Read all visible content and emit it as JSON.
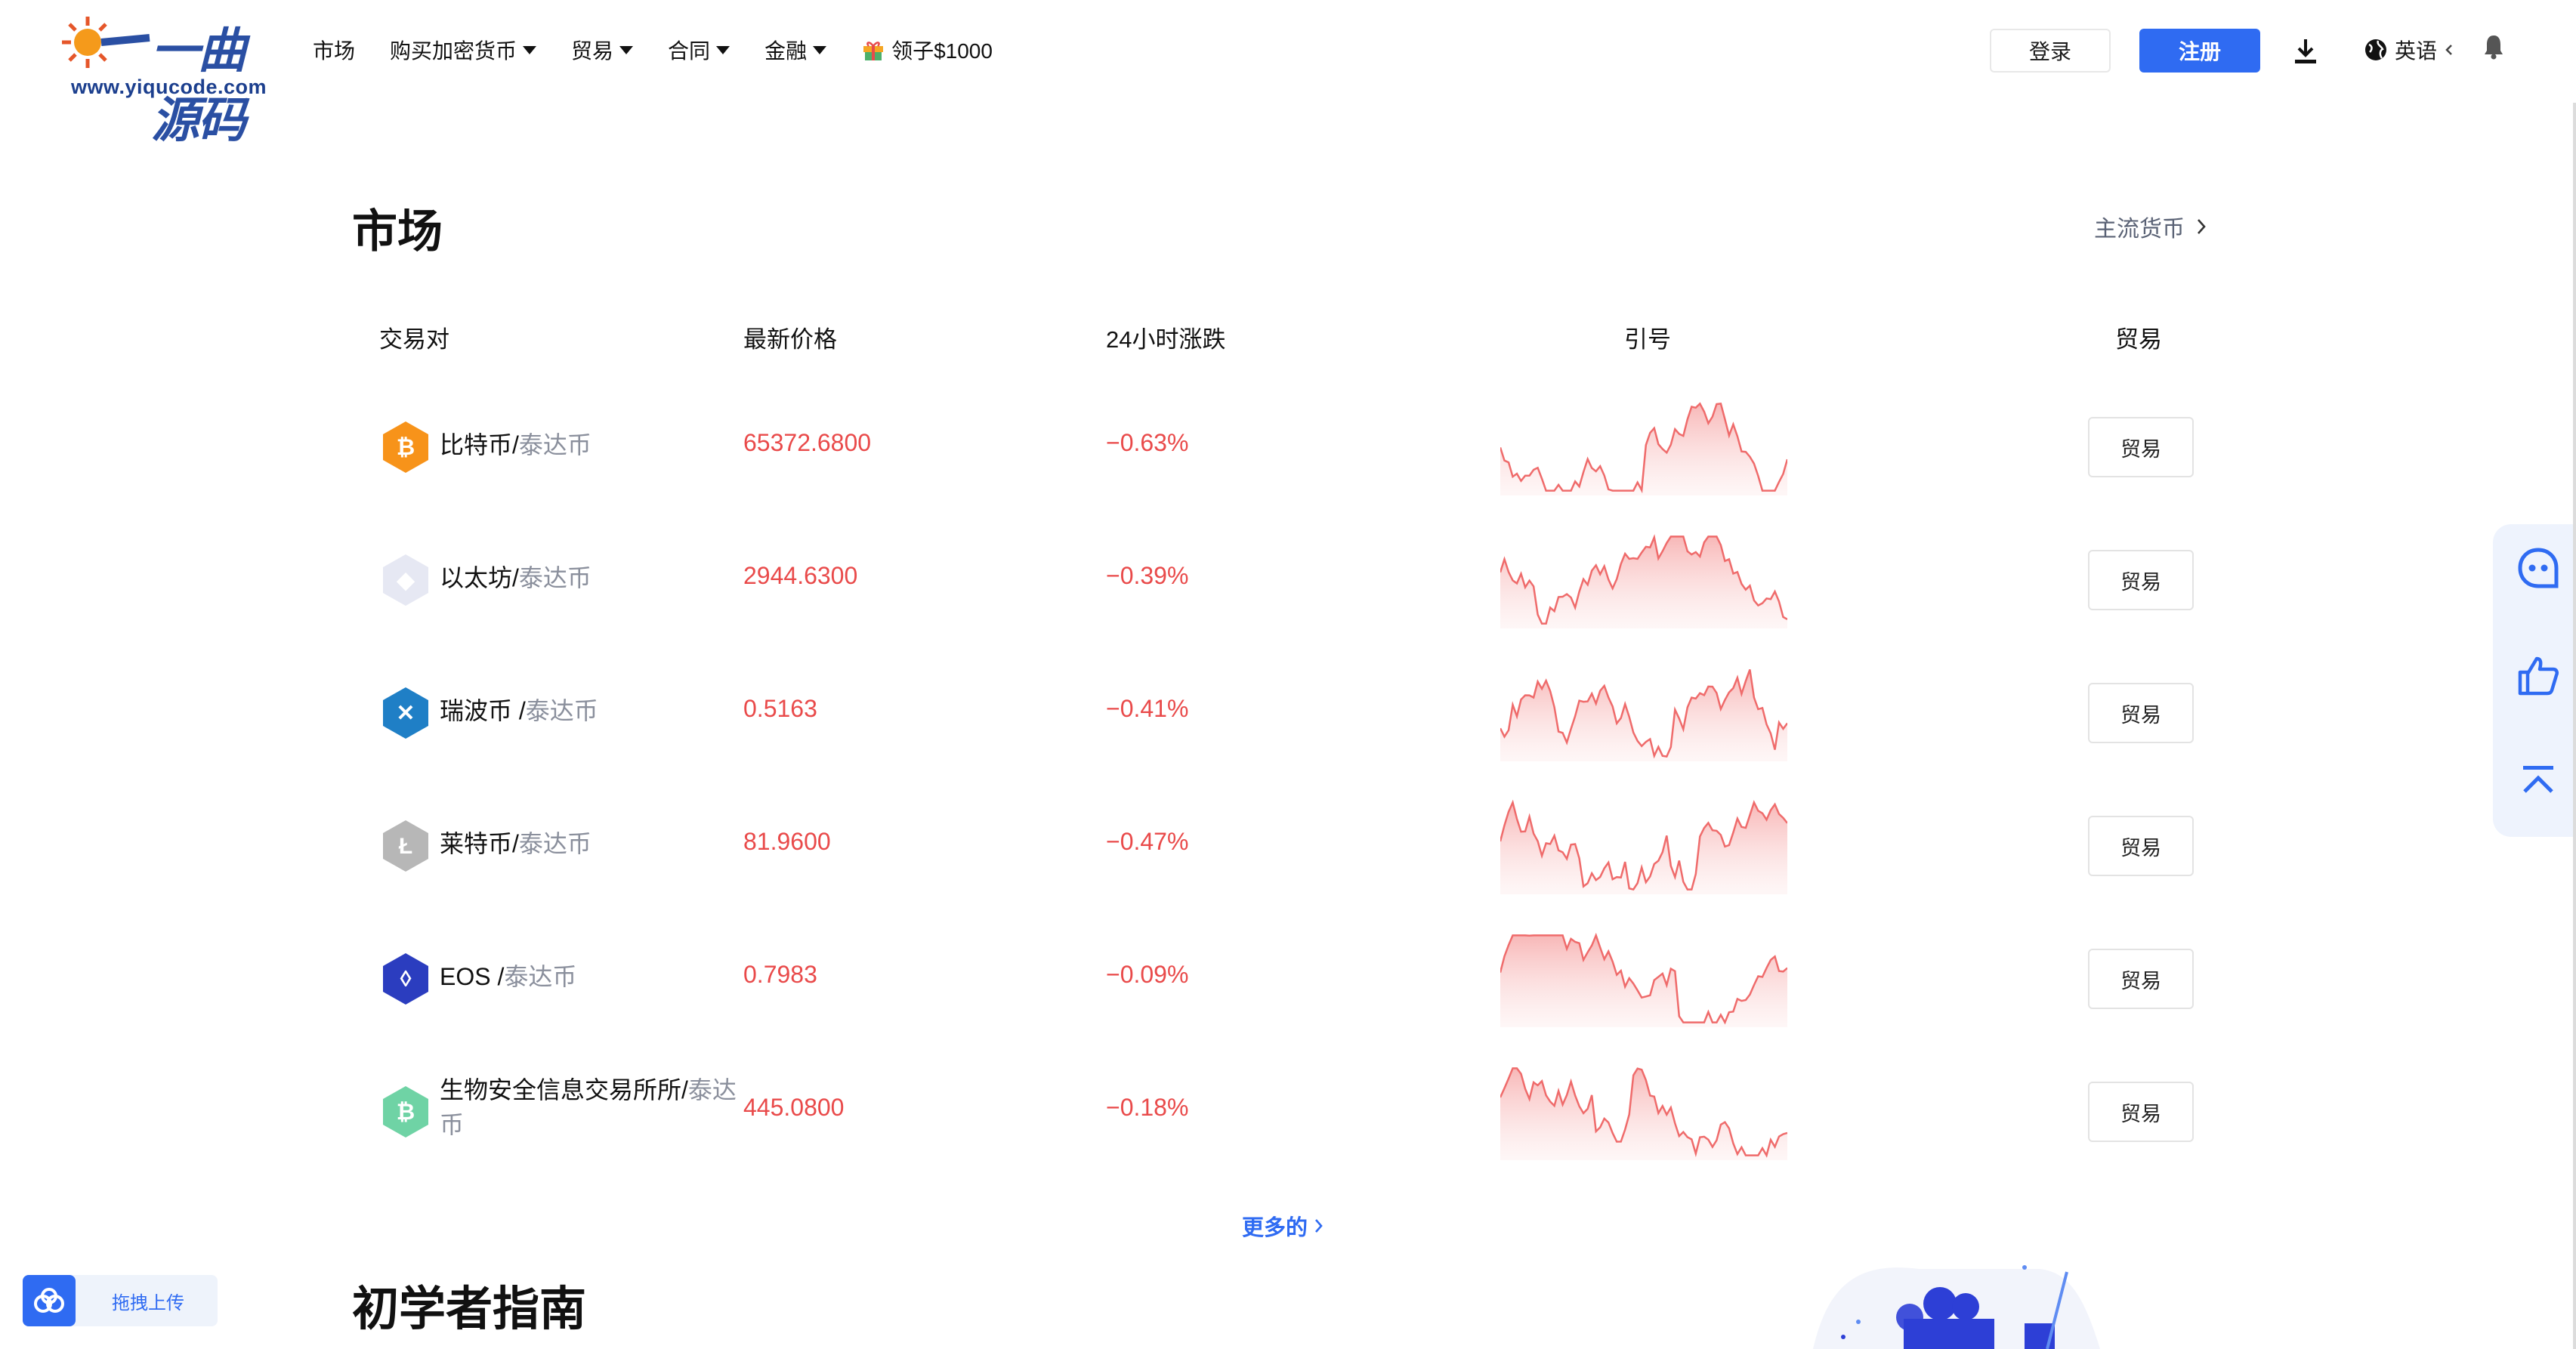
{
  "header": {
    "logo_text": "一曲源码",
    "logo_url": "www.yiqucode.com",
    "nav": [
      {
        "label": "市场",
        "dropdown": false
      },
      {
        "label": "购买加密货币",
        "dropdown": true
      },
      {
        "label": "贸易",
        "dropdown": true
      },
      {
        "label": "合同",
        "dropdown": true
      },
      {
        "label": "金融",
        "dropdown": true
      },
      {
        "label": "领子$1000",
        "dropdown": false,
        "icon": "gift-icon"
      }
    ],
    "login_label": "登录",
    "register_label": "注册",
    "language_label": "英语"
  },
  "market": {
    "title": "市场",
    "mainstream_link": "主流货币",
    "columns": [
      "交易对",
      "最新价格",
      "24小时涨跌",
      "引号",
      "贸易"
    ],
    "rows": [
      {
        "base": "比特币",
        "quote": "泰达币",
        "sep": "/",
        "price": "65372.6800",
        "change": "−0.63%",
        "icon": "bitcoin-icon",
        "icon_color": "#f7931a",
        "trade": "贸易"
      },
      {
        "base": "以太坊",
        "quote": "泰达币",
        "sep": "/",
        "price": "2944.6300",
        "change": "−0.39%",
        "icon": "ethereum-icon",
        "icon_color": "#e6e8f3",
        "trade": "贸易"
      },
      {
        "base": "瑞波币",
        "quote": "泰达币",
        "sep": " /",
        "price": "0.5163",
        "change": "−0.41%",
        "icon": "ripple-icon",
        "icon_color": "#1f7fc6",
        "trade": "贸易"
      },
      {
        "base": "莱特币",
        "quote": "泰达币",
        "sep": "/",
        "price": "81.9600",
        "change": "−0.47%",
        "icon": "litecoin-icon",
        "icon_color": "#b7b7b7",
        "trade": "贸易"
      },
      {
        "base": "EOS",
        "quote": "泰达币",
        "sep": " /",
        "price": "0.7983",
        "change": "−0.09%",
        "icon": "eos-icon",
        "icon_color": "#2b3dbf",
        "trade": "贸易"
      },
      {
        "base": "生物安全信息交易所所",
        "quote": "泰达币",
        "sep": "/",
        "price": "445.0800",
        "change": "−0.18%",
        "icon": "bsv-icon",
        "icon_color": "#6fd3a5",
        "trade": "贸易"
      }
    ],
    "more_label": "更多的"
  },
  "beginner_title": "初学者指南",
  "upload": {
    "label": "拖拽上传"
  },
  "colors": {
    "accent": "#2f6bf2",
    "down": "#e94a4a",
    "muted": "#8a8f9c"
  }
}
